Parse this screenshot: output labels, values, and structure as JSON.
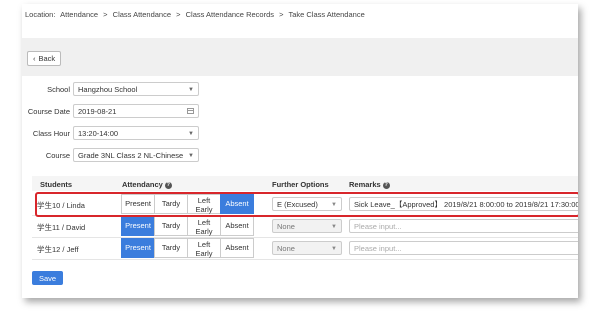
{
  "breadcrumb": {
    "prefix": "Location:",
    "items": [
      "Attendance",
      "Class Attendance",
      "Class Attendance Records",
      "Take Class Attendance"
    ],
    "separator": ">"
  },
  "back_label": "Back",
  "form": {
    "school": {
      "label": "School",
      "value": "Hangzhou School"
    },
    "course_date": {
      "label": "Course Date",
      "value": "2019-08-21"
    },
    "class_hour": {
      "label": "Class Hour",
      "value": "13:20-14:00"
    },
    "course": {
      "label": "Course",
      "value": "Grade 3NL Class 2 NL-Chinese"
    }
  },
  "table": {
    "headers": {
      "students": "Students",
      "attendancy": "Attendancy",
      "further": "Further Options",
      "remarks": "Remarks"
    },
    "options": {
      "present": "Present",
      "tardy": "Tardy",
      "left_early": [
        "Left",
        "Early"
      ],
      "absent": "Absent"
    },
    "rows": [
      {
        "student": "学生10 / Linda",
        "selected": "absent",
        "further": "E (Excused)",
        "remark": "Sick Leave_【Approved】 2019/8/21 8:00:00 to 2019/8/21 17:30:00"
      },
      {
        "student": "学生11 / David",
        "selected": "present",
        "further": "None",
        "remark_placeholder": "Please input..."
      },
      {
        "student": "学生12 / Jeff",
        "selected": "present",
        "further": "None",
        "remark_placeholder": "Please input..."
      }
    ]
  },
  "save_label": "Save",
  "colors": {
    "primary": "#3b7ddd",
    "highlight": "#d8262b"
  },
  "icons": {
    "help": "question-circle-icon",
    "back": "chevron-left-icon",
    "calendar": "calendar-icon",
    "dropdown": "chevron-down-icon"
  }
}
